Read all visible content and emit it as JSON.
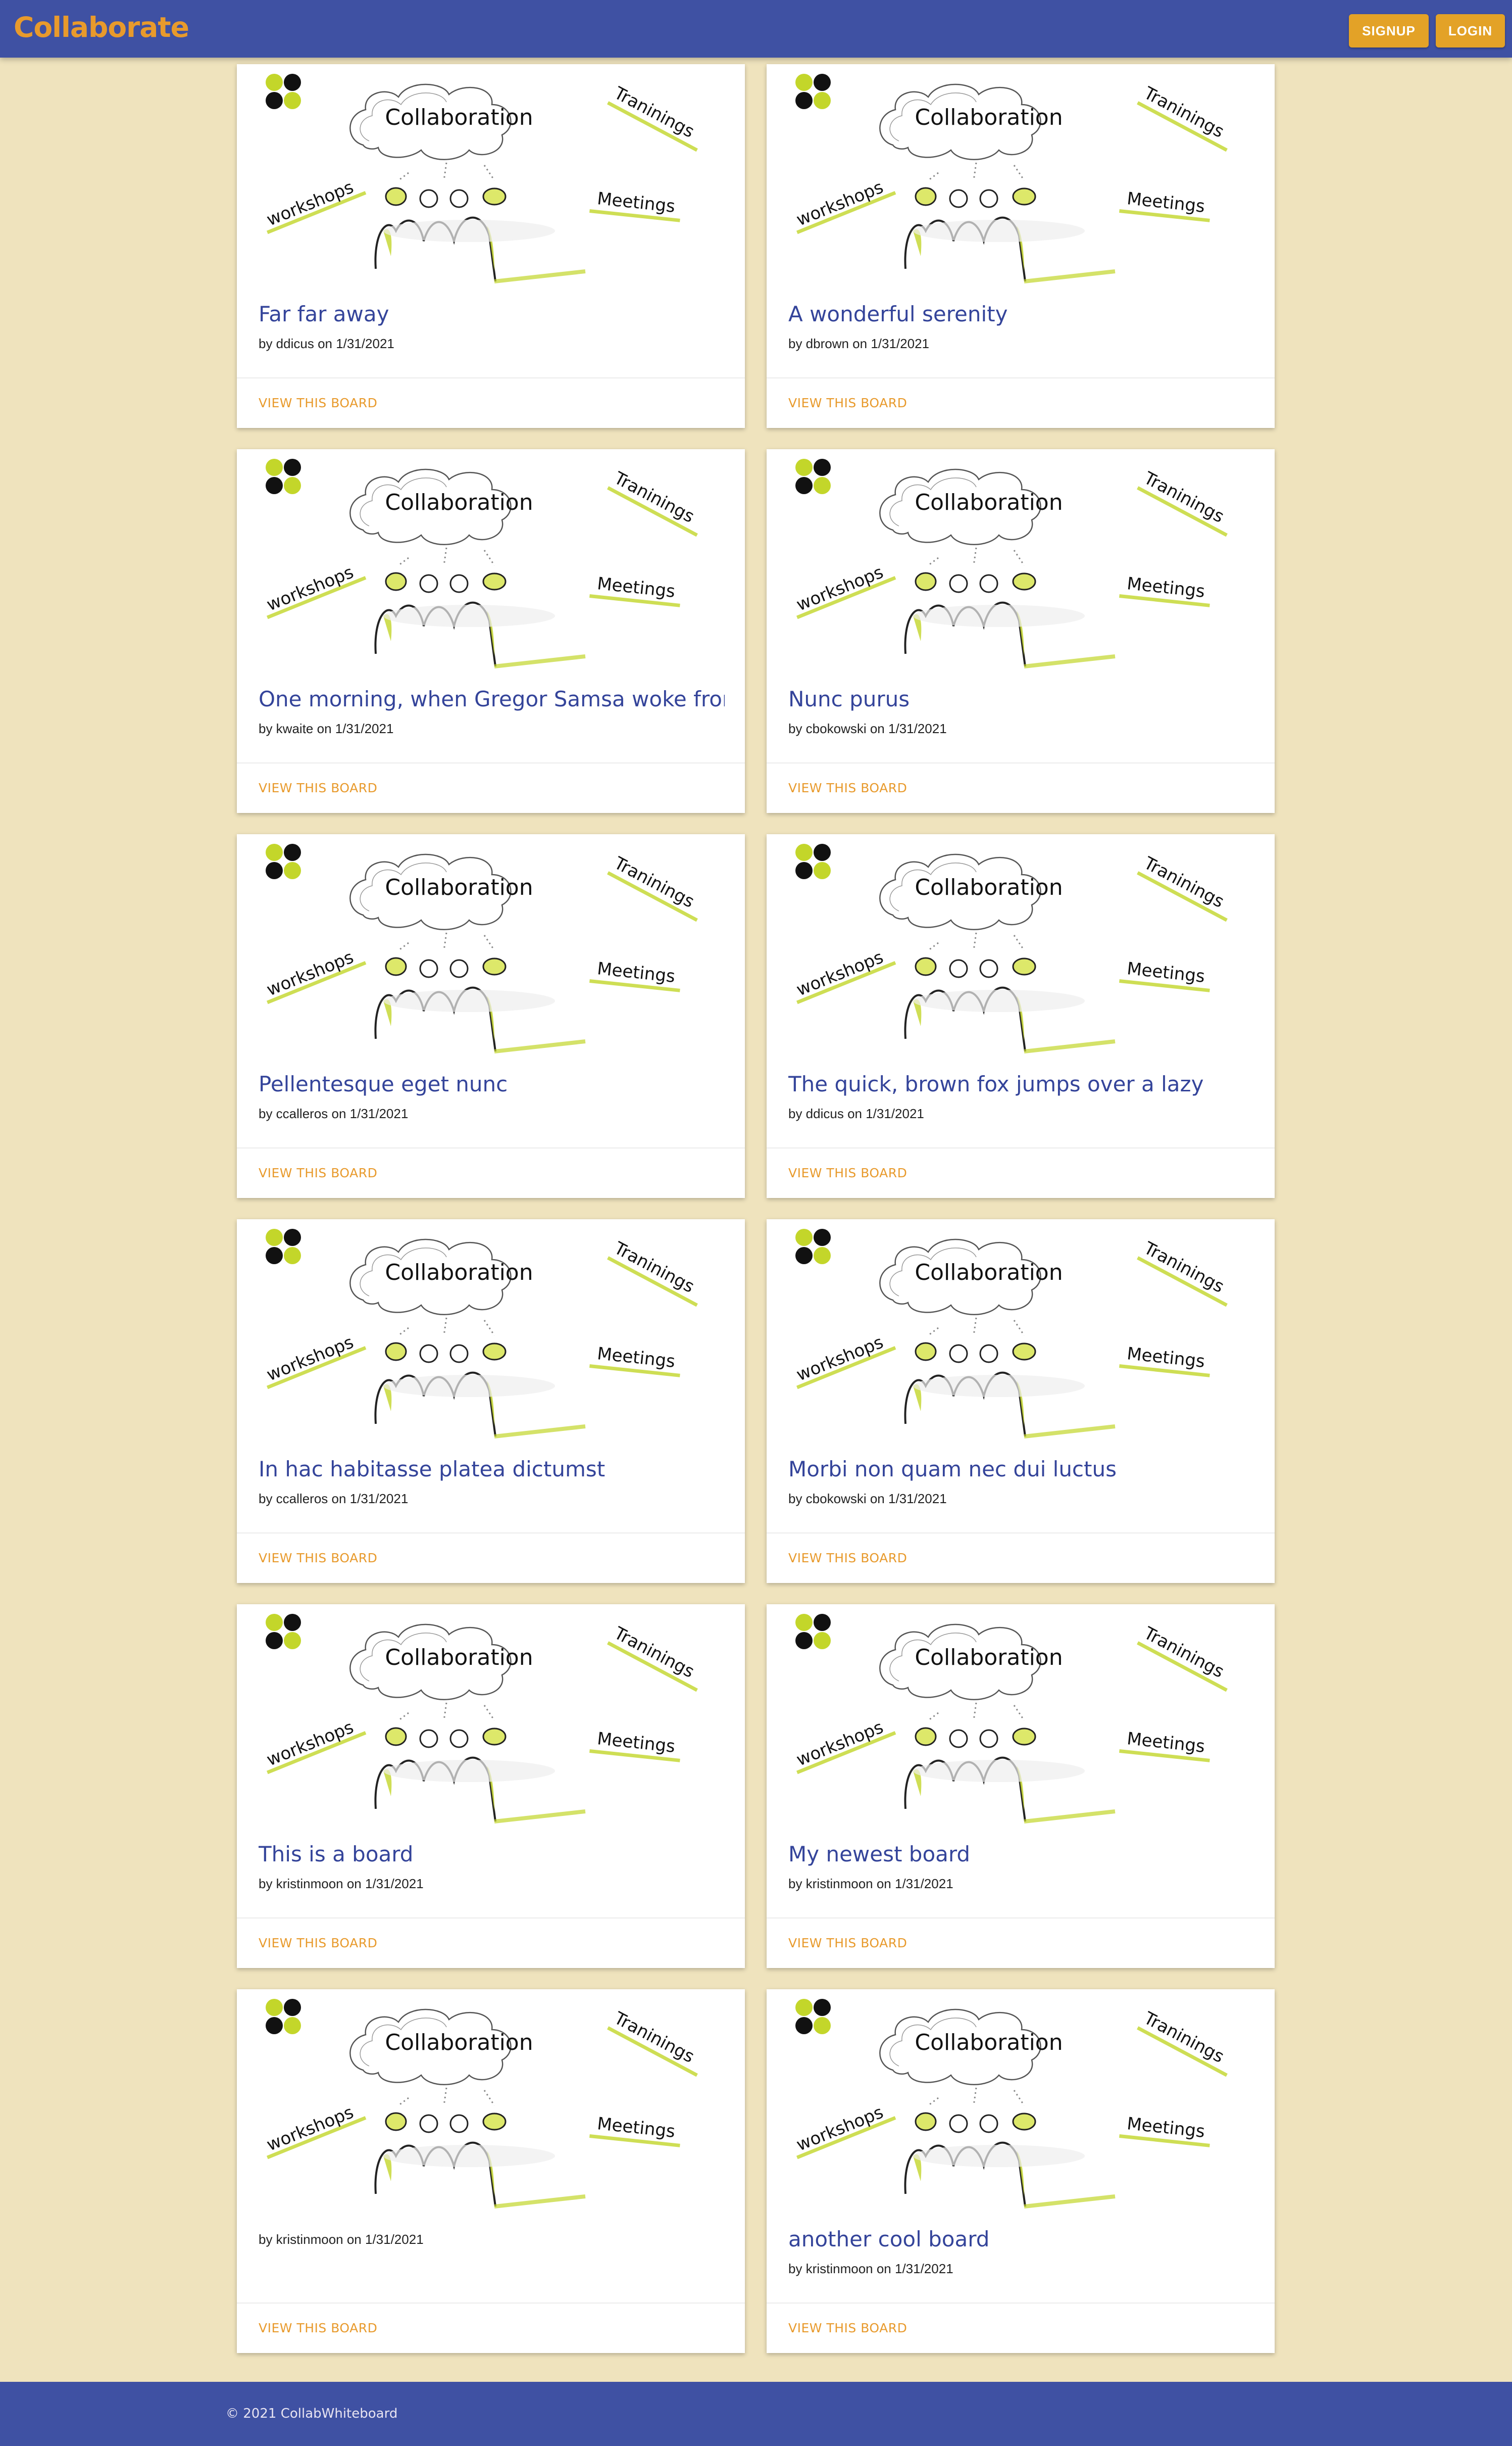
{
  "header": {
    "brand": "Collaborate",
    "signup_label": "SIGNUP",
    "login_label": "LOGIN"
  },
  "board_image": {
    "center_text": "Collaboration",
    "label_trainings": "Traninings",
    "label_workshops": "workshops",
    "label_meetings": "Meetings"
  },
  "boards": [
    {
      "title": "Far far away",
      "meta": "by ddicus on 1/31/2021",
      "action": "VIEW THIS BOARD"
    },
    {
      "title": "A wonderful serenity",
      "meta": "by dbrown on 1/31/2021",
      "action": "VIEW THIS BOARD"
    },
    {
      "title": "One morning, when Gregor Samsa woke from",
      "meta": "by kwaite on 1/31/2021",
      "action": "VIEW THIS BOARD"
    },
    {
      "title": "Nunc purus",
      "meta": "by cbokowski on 1/31/2021",
      "action": "VIEW THIS BOARD"
    },
    {
      "title": "Pellentesque eget nunc",
      "meta": "by ccalleros on 1/31/2021",
      "action": "VIEW THIS BOARD"
    },
    {
      "title": "The quick, brown fox jumps over a lazy",
      "meta": "by ddicus on 1/31/2021",
      "action": "VIEW THIS BOARD"
    },
    {
      "title": "In hac habitasse platea dictumst",
      "meta": "by ccalleros on 1/31/2021",
      "action": "VIEW THIS BOARD"
    },
    {
      "title": "Morbi non quam nec dui luctus",
      "meta": "by cbokowski on 1/31/2021",
      "action": "VIEW THIS BOARD"
    },
    {
      "title": "This is a board",
      "meta": "by kristinmoon on 1/31/2021",
      "action": "VIEW THIS BOARD"
    },
    {
      "title": "My newest board",
      "meta": "by kristinmoon on 1/31/2021",
      "action": "VIEW THIS BOARD"
    },
    {
      "title": "",
      "meta": "by kristinmoon on 1/31/2021",
      "action": "VIEW THIS BOARD"
    },
    {
      "title": "another cool board",
      "meta": "by kristinmoon on 1/31/2021",
      "action": "VIEW THIS BOARD"
    }
  ],
  "footer": {
    "copyright": "© 2021 CollabWhiteboard"
  },
  "colors": {
    "appbar": "#3f51a3",
    "accent": "#e3a227",
    "background": "#efe3bd",
    "title": "#34449a"
  }
}
